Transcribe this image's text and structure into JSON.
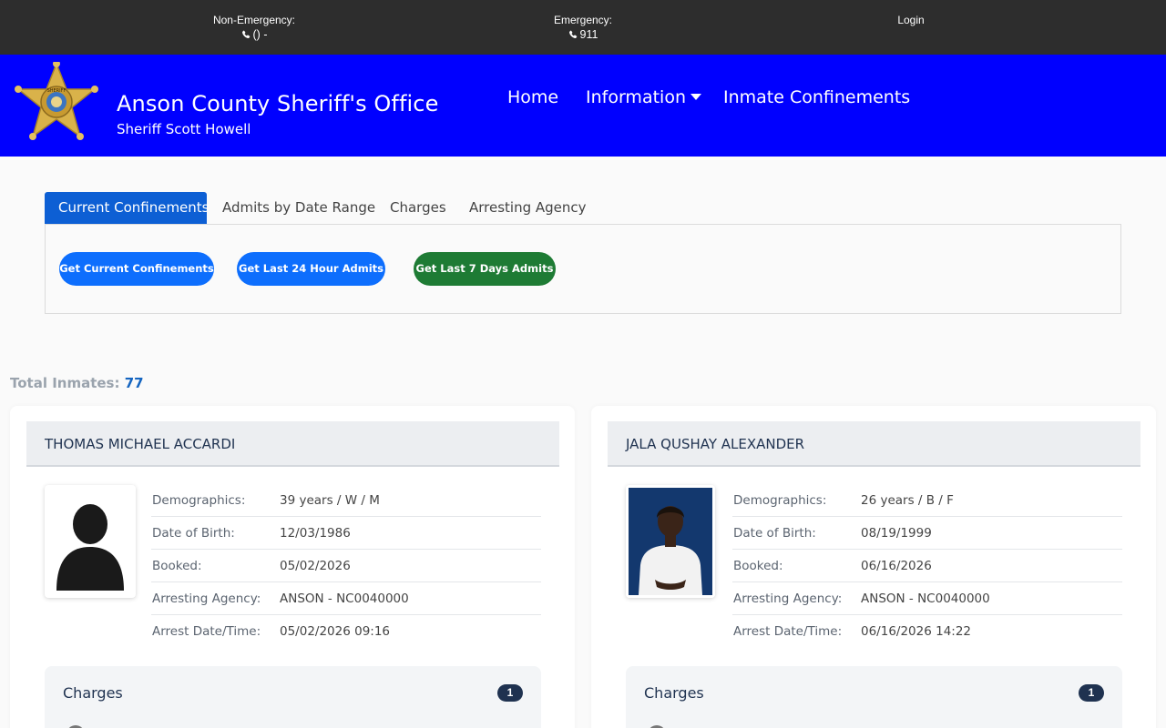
{
  "topbar": {
    "non_emergency_label": "Non-Emergency:",
    "non_emergency_value": "() -",
    "emergency_label": "Emergency:",
    "emergency_value": "911",
    "login_label": "Login"
  },
  "header": {
    "title": "Anson County Sheriff's Office",
    "subtitle": "Sheriff Scott Howell",
    "badge_text": "SHERIFF",
    "nav": {
      "home": "Home",
      "information": "Information",
      "inmate_confinements": "Inmate Confinements"
    }
  },
  "tabs": [
    "Current Confinements",
    "Admits by Date Range",
    "Charges",
    "Arresting Agency"
  ],
  "active_tab": "Current Confinements",
  "buttons": {
    "current": "Get Current Confinements",
    "last24": "Get Last 24 Hour Admits",
    "last7": "Get Last 7 Days Admits"
  },
  "total": {
    "label": "Total Inmates:",
    "count": "77"
  },
  "field_labels": {
    "demographics": "Demographics:",
    "dob": "Date of Birth:",
    "booked": "Booked:",
    "agency": "Arresting Agency:",
    "arrest": "Arrest Date/Time:"
  },
  "inmates": [
    {
      "name": "THOMAS MICHAEL ACCARDI",
      "photo": "silhouette-placeholder",
      "demographics": "39 years / W / M",
      "dob": "12/03/1986",
      "booked": "05/02/2026",
      "agency": "ANSON - NC0040000",
      "arrest": "05/02/2026 09:16",
      "charges_label": "Charges",
      "charges_count": "1"
    },
    {
      "name": "JALA QUSHAY ALEXANDER",
      "photo": "mugshot",
      "demographics": "26 years / B / F",
      "dob": "08/19/1999",
      "booked": "06/16/2026",
      "agency": "ANSON - NC0040000",
      "arrest": "06/16/2026 14:22",
      "charges_label": "Charges",
      "charges_count": "1"
    }
  ],
  "colors": {
    "topbar": "#2d2d2d",
    "header": "#0000ff",
    "tab_active": "#0d5fd4",
    "button_blue": "#0d6efd",
    "button_green": "#1e7b34",
    "navy": "#1f3250"
  }
}
